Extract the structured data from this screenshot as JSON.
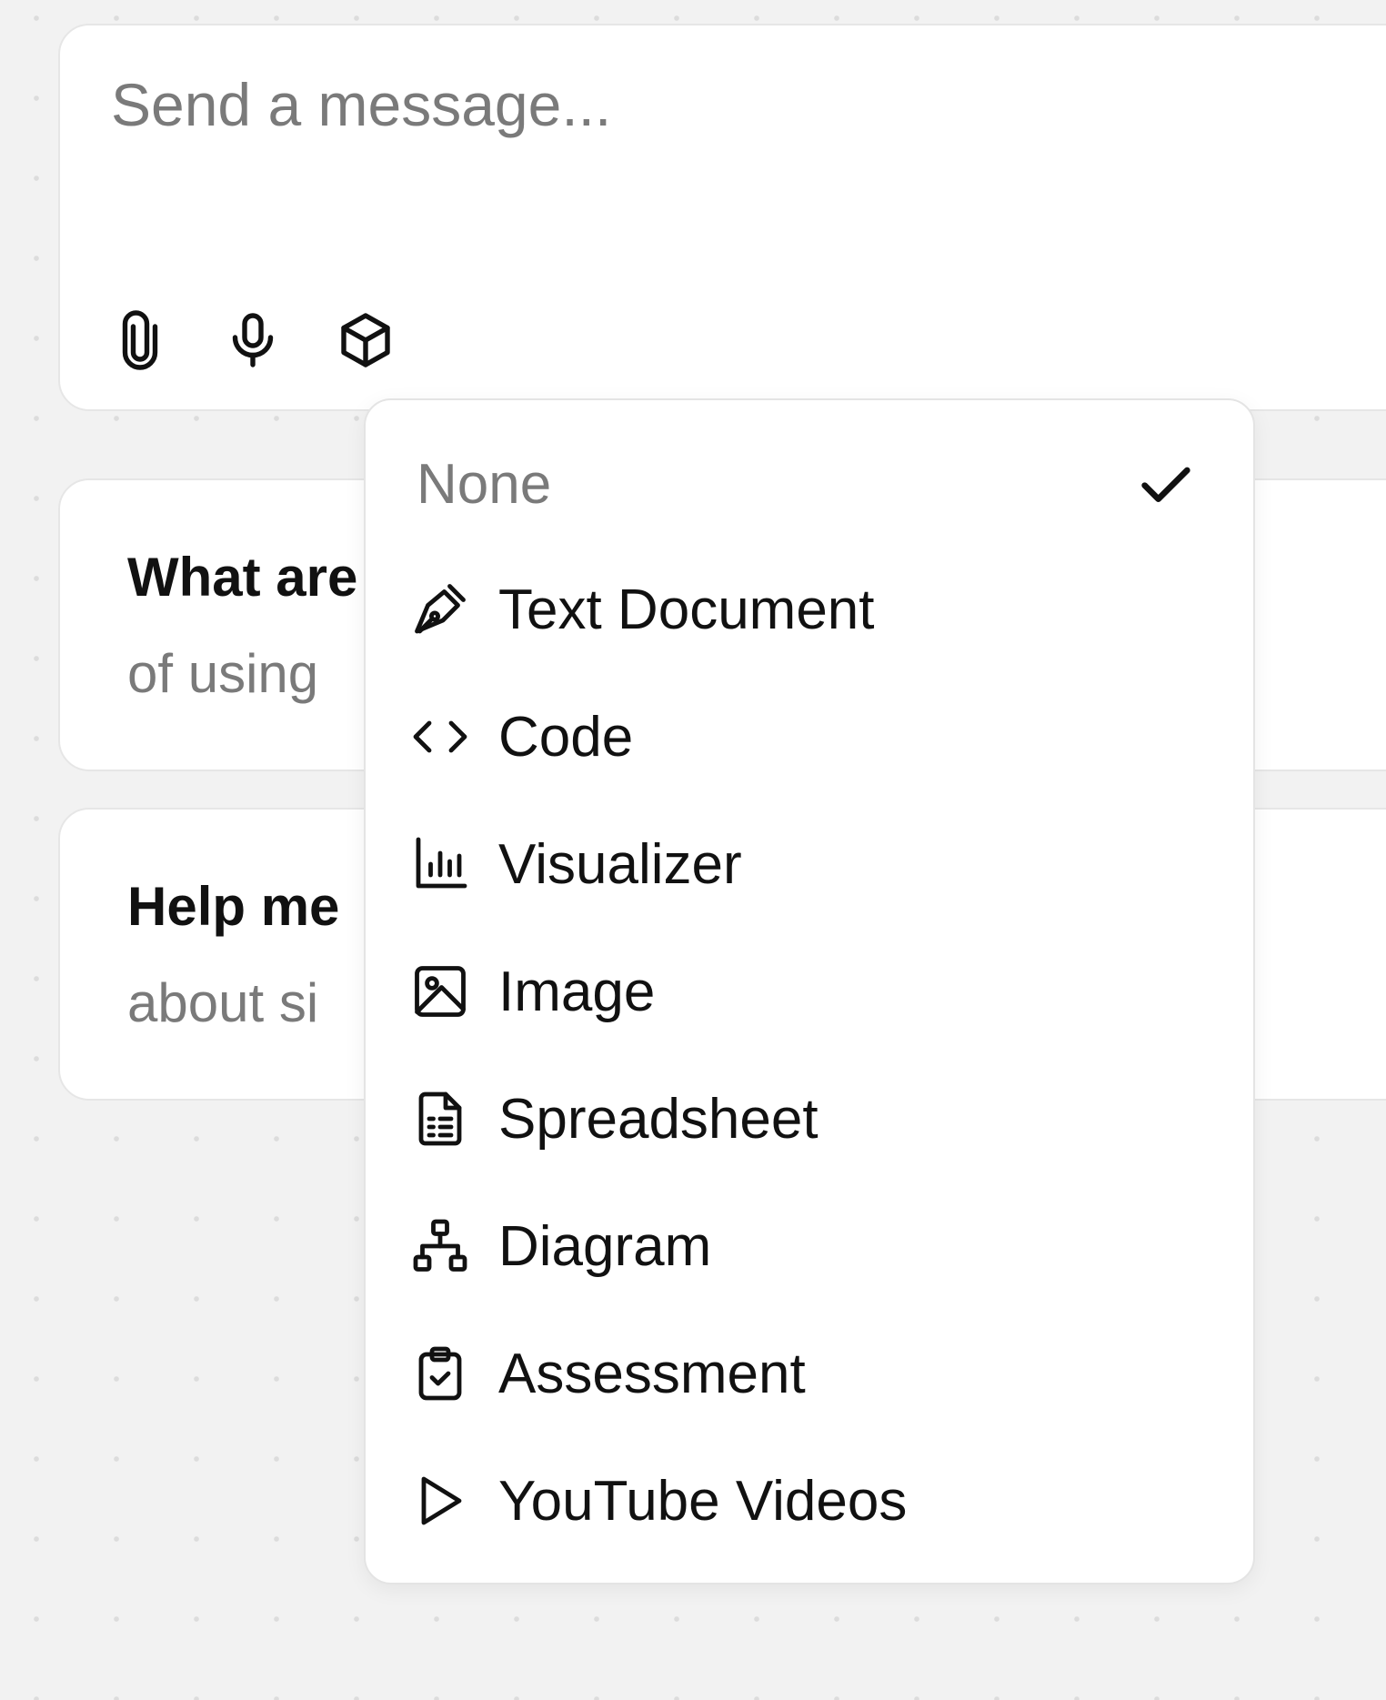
{
  "composer": {
    "placeholder": "Send a message...",
    "value": "",
    "tools": [
      "paperclip-icon",
      "microphone-icon",
      "cube-icon"
    ]
  },
  "suggestions": [
    {
      "title": "What are",
      "subtitle": "of using"
    },
    {
      "title": "Help me",
      "subtitle": "about si"
    }
  ],
  "dropdown": {
    "selected": "None",
    "items": [
      {
        "label": "None",
        "icon": "check-icon"
      },
      {
        "label": "Text Document",
        "icon": "pen-icon"
      },
      {
        "label": "Code",
        "icon": "code-icon"
      },
      {
        "label": "Visualizer",
        "icon": "bar-chart-icon"
      },
      {
        "label": "Image",
        "icon": "image-icon"
      },
      {
        "label": "Spreadsheet",
        "icon": "spreadsheet-icon"
      },
      {
        "label": "Diagram",
        "icon": "diagram-icon"
      },
      {
        "label": "Assessment",
        "icon": "clipboard-check-icon"
      },
      {
        "label": "YouTube Videos",
        "icon": "play-icon"
      }
    ]
  }
}
